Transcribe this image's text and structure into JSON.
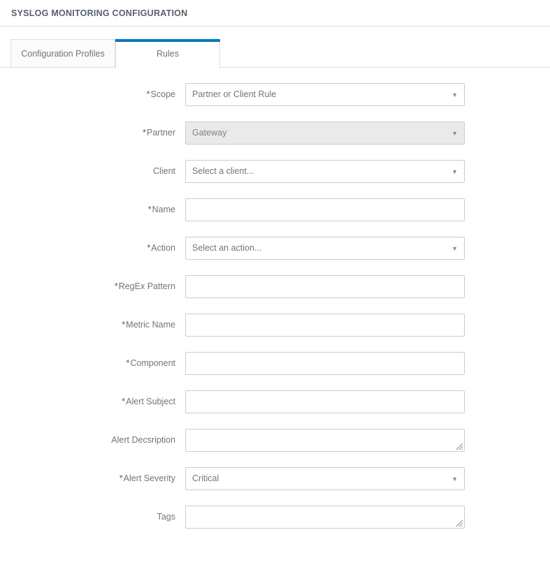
{
  "header": {
    "title": "SYSLOG MONITORING CONFIGURATION"
  },
  "tabs": [
    {
      "label": "Configuration Profiles",
      "active": false
    },
    {
      "label": "Rules",
      "active": true
    }
  ],
  "form": {
    "fields": [
      {
        "label": "Scope",
        "required": true,
        "type": "select",
        "value": "Partner or Client Rule",
        "disabled": false
      },
      {
        "label": "Partner",
        "required": true,
        "type": "select",
        "value": "Gateway",
        "disabled": true
      },
      {
        "label": "Client",
        "required": false,
        "type": "select",
        "value": "Select a client...",
        "disabled": false
      },
      {
        "label": "Name",
        "required": true,
        "type": "text",
        "value": "",
        "placeholder": ""
      },
      {
        "label": "Action",
        "required": true,
        "type": "select",
        "value": "Select an action...",
        "disabled": false
      },
      {
        "label": "RegEx Pattern",
        "required": true,
        "type": "text",
        "value": "",
        "placeholder": ""
      },
      {
        "label": "Metric Name",
        "required": true,
        "type": "text",
        "value": "",
        "placeholder": ""
      },
      {
        "label": "Component",
        "required": true,
        "type": "text",
        "value": "",
        "placeholder": ""
      },
      {
        "label": "Alert Subject",
        "required": true,
        "type": "text",
        "value": "",
        "placeholder": ""
      },
      {
        "label": "Alert Decsription",
        "required": false,
        "type": "textarea",
        "value": "",
        "placeholder": ""
      },
      {
        "label": "Alert Severity",
        "required": true,
        "type": "select",
        "value": "Critical",
        "disabled": false
      },
      {
        "label": "Tags",
        "required": false,
        "type": "textarea",
        "value": "",
        "placeholder": ""
      }
    ]
  },
  "icons": {
    "caret": "▼"
  },
  "colors": {
    "accent": "#0079c1",
    "required_asterisk": "#a33b3b",
    "border": "#cccccc",
    "disabled_bg": "#eaeaea",
    "label_text": "#6f7679"
  }
}
